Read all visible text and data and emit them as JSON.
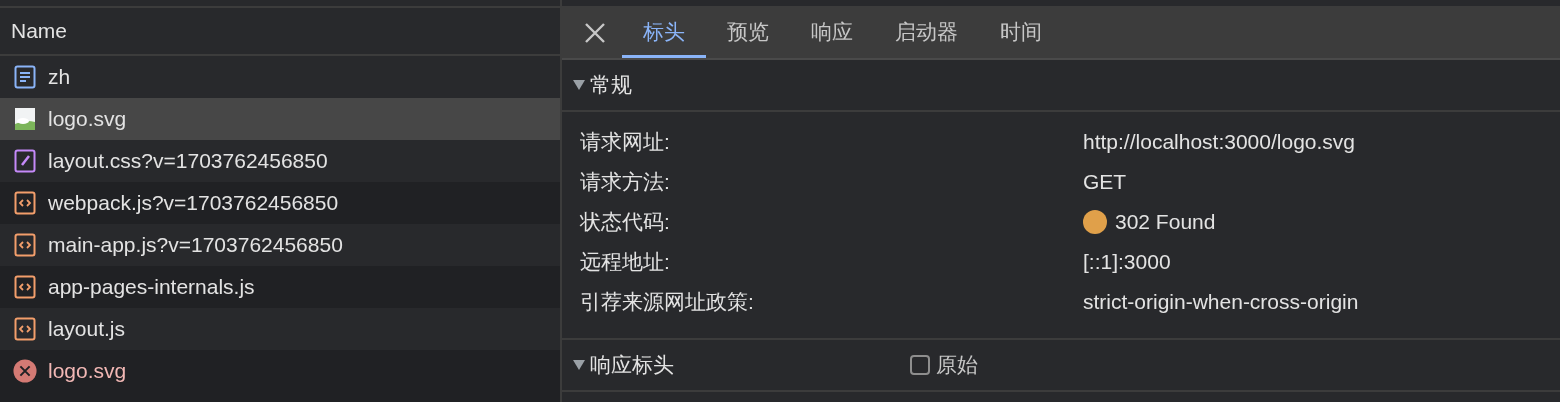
{
  "requests": {
    "header": "Name",
    "rows": [
      {
        "name": "zh",
        "kind": "document",
        "selected": false
      },
      {
        "name": "logo.svg",
        "kind": "image",
        "selected": true
      },
      {
        "name": "layout.css?v=1703762456850",
        "kind": "stylesheet",
        "selected": false
      },
      {
        "name": "webpack.js?v=1703762456850",
        "kind": "script",
        "selected": false
      },
      {
        "name": "main-app.js?v=1703762456850",
        "kind": "script",
        "selected": false
      },
      {
        "name": "app-pages-internals.js",
        "kind": "script",
        "selected": false
      },
      {
        "name": "layout.js",
        "kind": "script",
        "selected": false
      },
      {
        "name": "logo.svg",
        "kind": "error",
        "selected": false
      }
    ]
  },
  "details": {
    "tabs": [
      {
        "label": "标头",
        "selected": true
      },
      {
        "label": "预览",
        "selected": false
      },
      {
        "label": "响应",
        "selected": false
      },
      {
        "label": "启动器",
        "selected": false
      },
      {
        "label": "时间",
        "selected": false
      }
    ],
    "general": {
      "title": "常规",
      "expanded": true,
      "rows": [
        {
          "label": "请求网址:",
          "value": "http://localhost:3000/logo.svg"
        },
        {
          "label": "请求方法:",
          "value": "GET"
        },
        {
          "label": "状态代码:",
          "value": "302 Found",
          "color": "#e0a04a"
        },
        {
          "label": "远程地址:",
          "value": "[::1]:3000"
        },
        {
          "label": "引荐来源网址政策:",
          "value": "strict-origin-when-cross-origin"
        }
      ]
    },
    "response_headers": {
      "title": "响应标头",
      "expanded": true,
      "raw": {
        "label": "原始",
        "checked": false
      }
    }
  }
}
